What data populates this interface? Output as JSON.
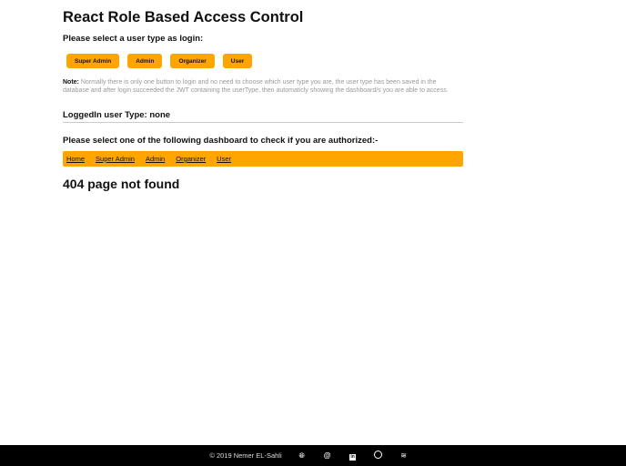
{
  "title": "React Role Based Access Control",
  "select_prompt": "Please select a user type as login:",
  "login_buttons": [
    "Super Admin",
    "Admin",
    "Organizer",
    "User"
  ],
  "note_label": "Note:",
  "note_text": " Normally there is only one button to login and no need to choose which user type you are, the user type has been saved in the database and after login succeeded the JWT containing the userType, then automaticly showing the dashboard/s you are able to access.",
  "logged_in": "LoggedIn user Type: none",
  "dashboard_prompt": "Please select one of the following dashboard to check if you are authorized:-",
  "nav": [
    "Home",
    "Super Admin",
    "Admin",
    "Organizer",
    "User"
  ],
  "message": "404 page not found",
  "footer": {
    "copyright": "© 2019 Nemer EL-Sahli",
    "icons": [
      "globe-icon",
      "at-icon",
      "linkedin-icon",
      "github-icon",
      "stackoverflow-icon"
    ]
  }
}
